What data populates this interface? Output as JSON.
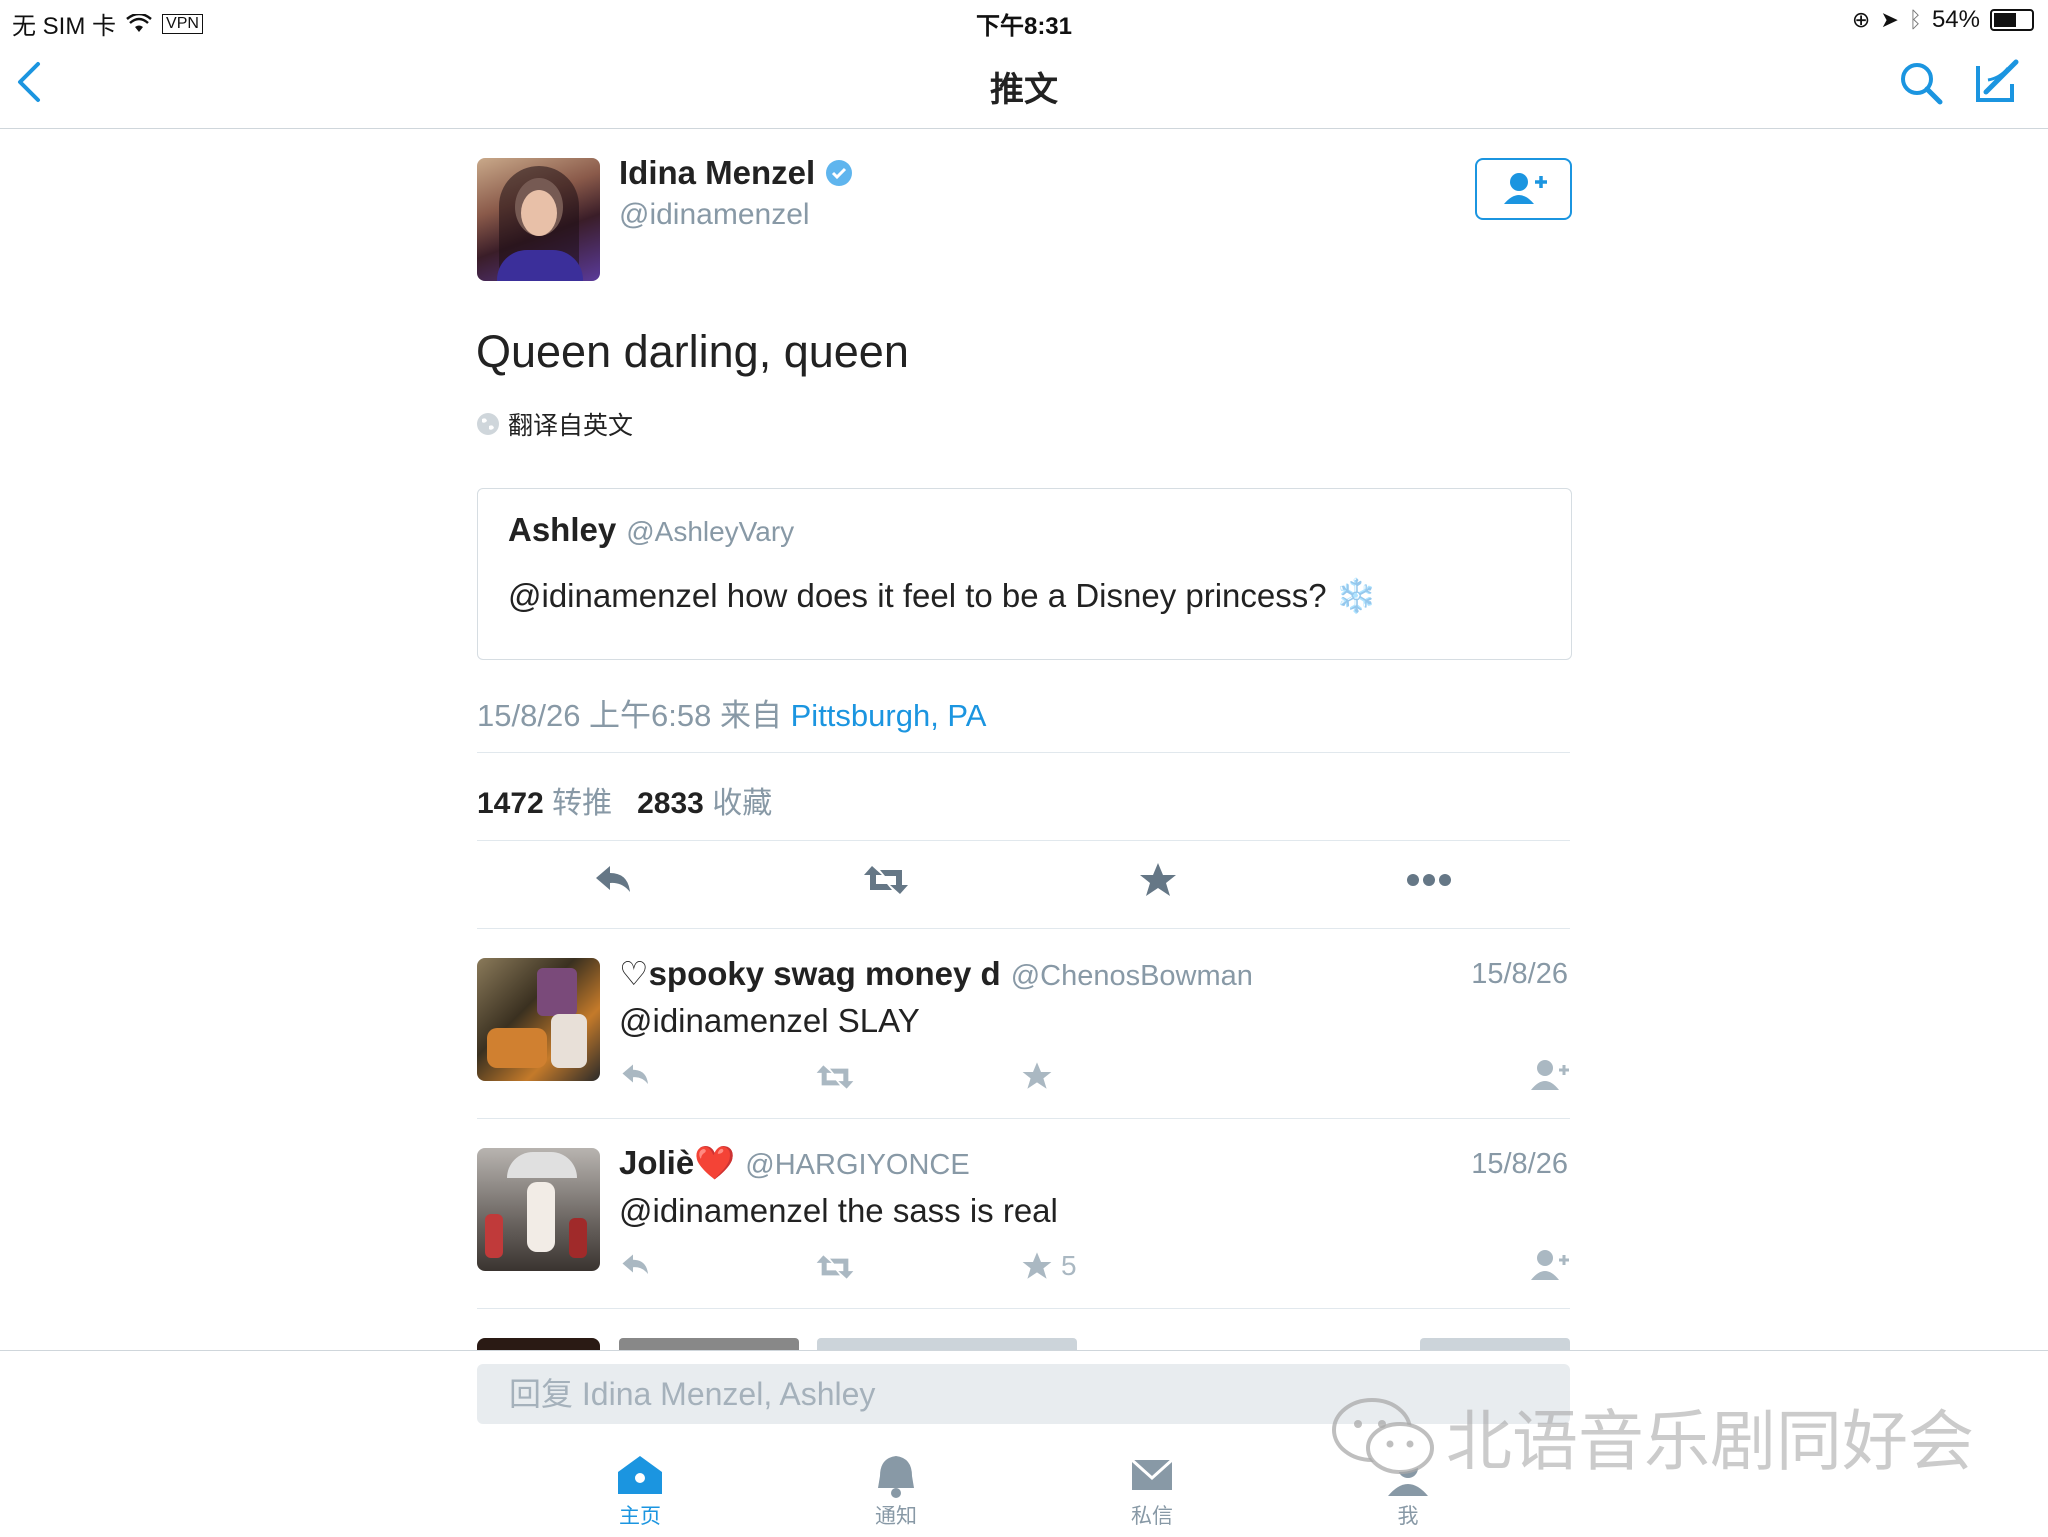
{
  "status_bar": {
    "carrier": "无 SIM 卡",
    "vpn": "VPN",
    "time": "下午8:31",
    "battery": "54%",
    "battery_level": 0.54
  },
  "nav": {
    "title": "推文"
  },
  "tweet": {
    "author_name": "Idina Menzel",
    "author_handle": "@idinamenzel",
    "text": "Queen darling, queen",
    "translate": "翻译自英文",
    "quote": {
      "name": "Ashley",
      "handle": "@AshleyVary",
      "text": "@idinamenzel how does it feel to be a Disney princess? ❄️"
    },
    "date": "15/8/26 上午6:58 来自",
    "location": "Pittsburgh, PA",
    "retweets_count": "1472",
    "retweets_label": "转推",
    "favorites_count": "2833",
    "favorites_label": "收藏"
  },
  "replies": [
    {
      "name": "♡spooky swag money d",
      "handle": "@ChenosBowman",
      "date": "15/8/26",
      "text": "@idinamenzel SLAY",
      "fav_count": ""
    },
    {
      "name": "Joliè❤️",
      "handle": "@HARGIYONCE",
      "date": "15/8/26",
      "text": "@idinamenzel the sass is real",
      "fav_count": "5"
    }
  ],
  "reply_placeholder": "回复 Idina Menzel, Ashley",
  "tabs": [
    {
      "label": "主页",
      "icon": "home-icon"
    },
    {
      "label": "通知",
      "icon": "bell-icon"
    },
    {
      "label": "私信",
      "icon": "mail-icon"
    },
    {
      "label": "我",
      "icon": "person-icon"
    }
  ],
  "watermark": "北语音乐剧同好会",
  "colors": {
    "accent": "#1b95e0",
    "muted": "#8899a6"
  }
}
